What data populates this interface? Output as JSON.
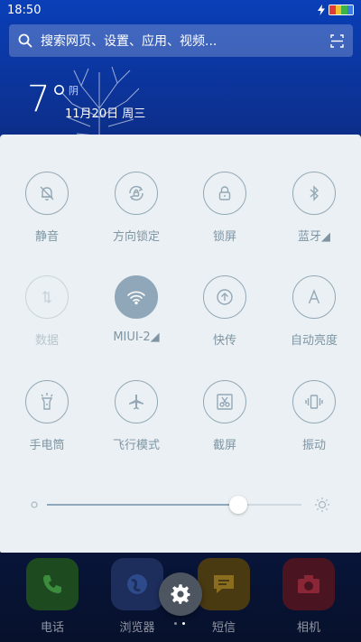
{
  "status_bar": {
    "time": "18:50"
  },
  "search": {
    "placeholder": "搜索网页、设置、应用、视频..."
  },
  "weather": {
    "temperature": "7°",
    "condition": "阴",
    "date": "11月20日 周三"
  },
  "quick_settings": {
    "toggles": [
      {
        "label": "静音",
        "icon": "mute-bell-icon",
        "state": "off"
      },
      {
        "label": "方向锁定",
        "icon": "rotation-lock-icon",
        "state": "off"
      },
      {
        "label": "锁屏",
        "icon": "lock-icon",
        "state": "off"
      },
      {
        "label": "蓝牙◢",
        "icon": "bluetooth-icon",
        "state": "off"
      },
      {
        "label": "数据",
        "icon": "mobile-data-icon",
        "state": "disabled"
      },
      {
        "label": "MIUI-2◢",
        "icon": "wifi-icon",
        "state": "on"
      },
      {
        "label": "快传",
        "icon": "quick-transfer-icon",
        "state": "off"
      },
      {
        "label": "自动亮度",
        "icon": "auto-brightness-icon",
        "state": "off"
      },
      {
        "label": "手电筒",
        "icon": "flashlight-icon",
        "state": "off"
      },
      {
        "label": "飞行模式",
        "icon": "airplane-icon",
        "state": "off"
      },
      {
        "label": "截屏",
        "icon": "screenshot-icon",
        "state": "off"
      },
      {
        "label": "振动",
        "icon": "vibrate-icon",
        "state": "off"
      }
    ],
    "brightness_level": 0.75
  },
  "dock": [
    {
      "label": "电话",
      "icon": "phone-icon",
      "color": "#1d4a1f"
    },
    {
      "label": "浏览器",
      "icon": "browser-icon",
      "color": "#1d2d5c"
    },
    {
      "label": "短信",
      "icon": "message-icon",
      "color": "#4a3a12"
    },
    {
      "label": "相机",
      "icon": "camera-icon",
      "color": "#4a1420"
    }
  ],
  "colors": {
    "panel_bg": "#eaf0f3",
    "icon_stroke": "#93a8b6",
    "active": "#8fa7b8"
  }
}
